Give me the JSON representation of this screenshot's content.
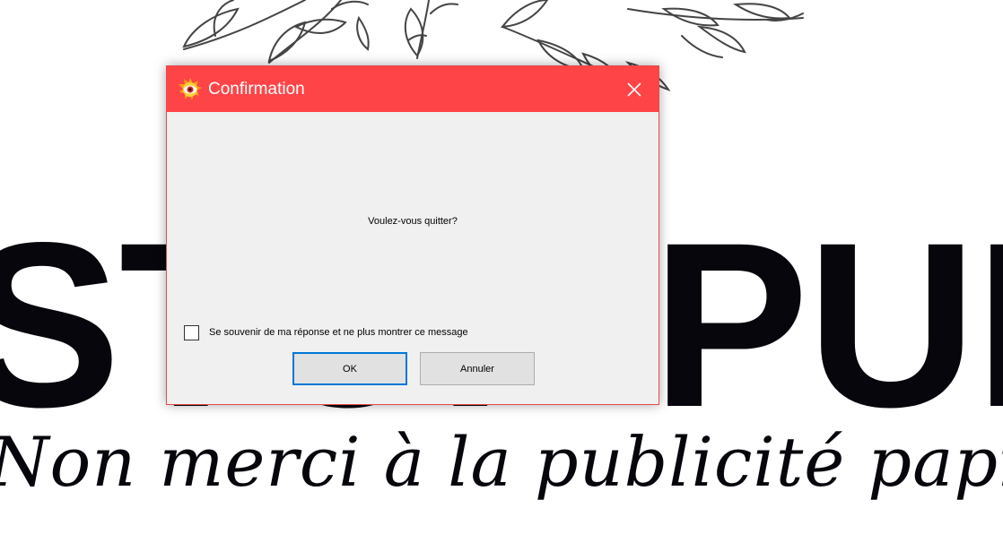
{
  "background": {
    "brand_text": "STOP PUB",
    "slogan": "Non merci à la publicité papier"
  },
  "dialog": {
    "title": "Confirmation",
    "app_icon": "eye-logo-icon",
    "close_icon": "close-icon",
    "message": "Voulez-vous quitter?",
    "remember_checkbox": {
      "label": "Se souvenir de ma réponse et ne plus montrer ce message",
      "checked": false
    },
    "ok_label": "OK",
    "cancel_label": "Annuler"
  },
  "colors": {
    "titlebar": "#ff4447",
    "dialog_bg": "#f0f0f0",
    "focus_border": "#0078d7"
  }
}
